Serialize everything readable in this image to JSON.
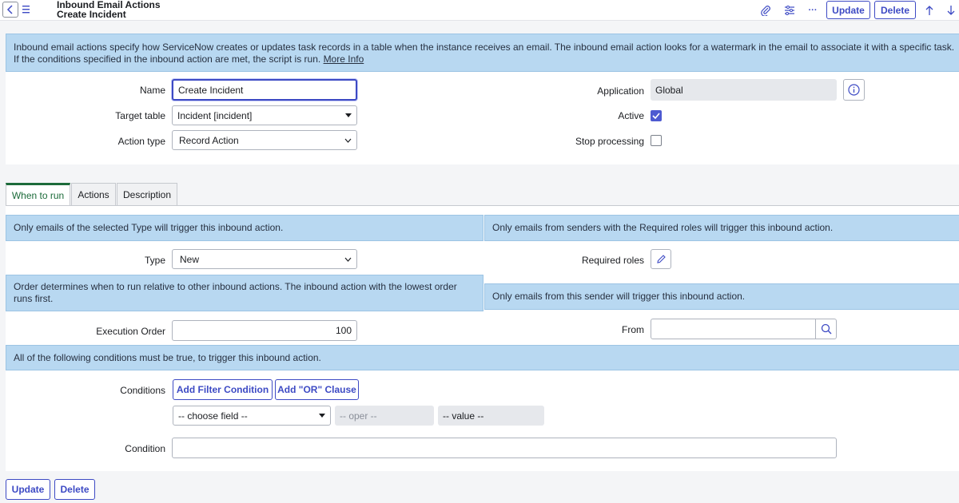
{
  "header": {
    "title_line1": "Inbound Email Actions",
    "title_line2": "Create Incident",
    "update_label": "Update",
    "delete_label": "Delete",
    "more_label": "···"
  },
  "info": {
    "text": "Inbound email actions specify how ServiceNow creates or updates task records in a table when the instance receives an email. The inbound email action looks for a watermark in the email to associate it with a specific task. If the conditions specified in the inbound action are met, the script is run.",
    "link": "More Info"
  },
  "form": {
    "name_label": "Name",
    "name_value": "Create Incident",
    "target_table_label": "Target table",
    "target_table_value": "Incident [incident]",
    "action_type_label": "Action type",
    "action_type_value": "Record Action",
    "application_label": "Application",
    "application_value": "Global",
    "active_label": "Active",
    "active_checked": true,
    "stop_processing_label": "Stop processing",
    "stop_processing_checked": false
  },
  "tabs": [
    {
      "label": "When to run",
      "active": true
    },
    {
      "label": "Actions",
      "active": false
    },
    {
      "label": "Description",
      "active": false
    }
  ],
  "when_to_run": {
    "type_note": "Only emails of the selected Type will trigger this inbound action.",
    "type_label": "Type",
    "type_value": "New",
    "order_note": "Order determines when to run relative to other inbound actions. The inbound action with the lowest order runs first.",
    "execution_order_label": "Execution Order",
    "execution_order_value": "100",
    "conditions_note": "All of the following conditions must be true, to trigger this inbound action.",
    "conditions_label": "Conditions",
    "add_filter_label": "Add Filter Condition",
    "add_or_label": "Add \"OR\" Clause",
    "choose_field": "-- choose field --",
    "oper": "-- oper --",
    "value": "-- value --",
    "condition_label": "Condition",
    "condition_value": "",
    "roles_note": "Only emails from senders with the Required roles will trigger this inbound action.",
    "required_roles_label": "Required roles",
    "sender_note": "Only emails from this sender will trigger this inbound action.",
    "from_label": "From",
    "from_value": ""
  },
  "footer": {
    "update_label": "Update",
    "delete_label": "Delete"
  },
  "colors": {
    "accent": "#3d4ac4",
    "info_bg": "#b8d8f1",
    "tab_active": "#1c6b3a"
  }
}
